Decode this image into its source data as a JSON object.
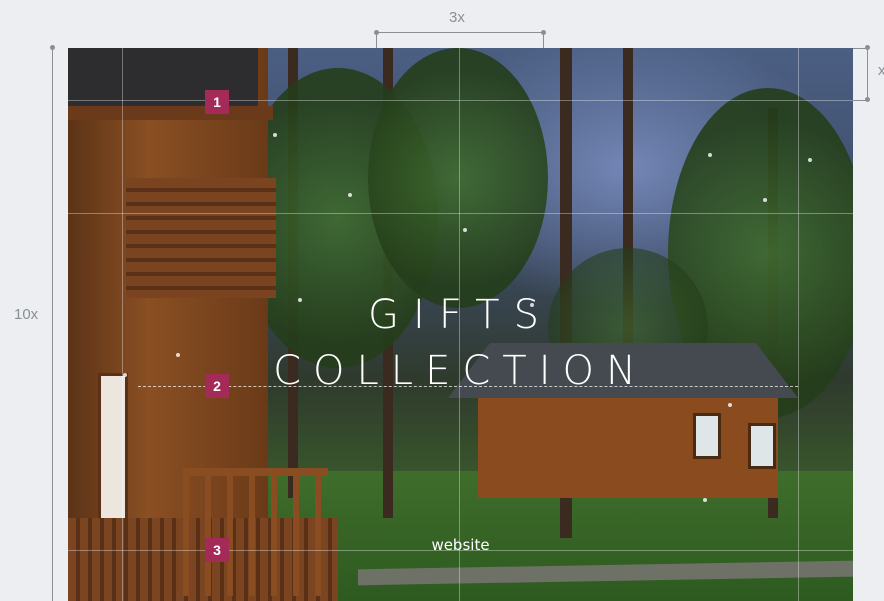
{
  "dimensions": {
    "top_width_label": "3x",
    "left_height_label": "10x",
    "right_margin_label": "x"
  },
  "artboard": {
    "title_line1": "GIFTS",
    "title_line2": "COLLECTION",
    "footer_text": "website"
  },
  "markers": [
    "1",
    "2",
    "3"
  ],
  "colors": {
    "marker": "#a42a58",
    "guide": "#8a8f96",
    "canvas": "#eceef1"
  }
}
